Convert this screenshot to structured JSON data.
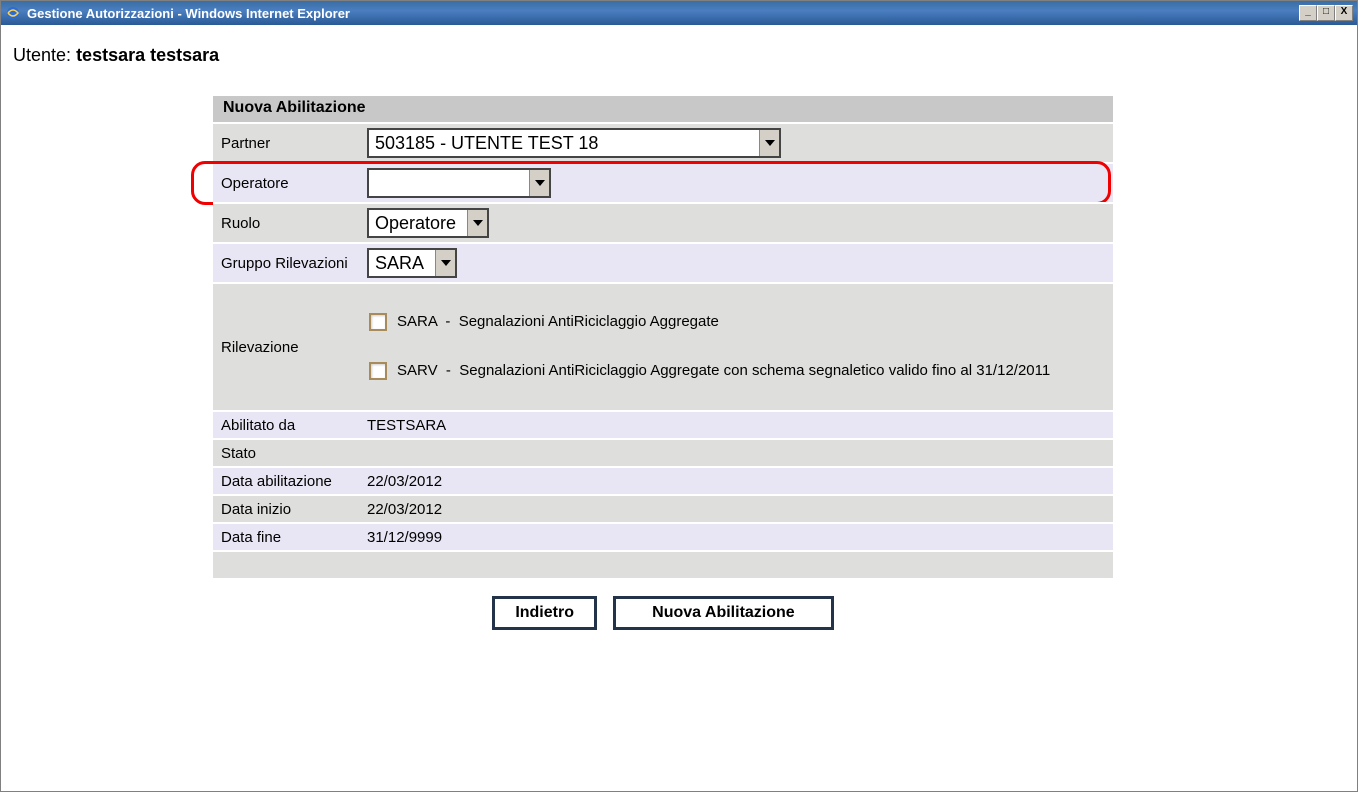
{
  "window": {
    "title": "Gestione Autorizzazioni - Windows Internet Explorer"
  },
  "user": {
    "label": "Utente:",
    "value": "testsara  testsara"
  },
  "panel": {
    "title": "Nuova Abilitazione"
  },
  "form": {
    "partner": {
      "label": "Partner",
      "value": "503185 - UTENTE TEST 18"
    },
    "operatore": {
      "label": "Operatore",
      "value": ""
    },
    "ruolo": {
      "label": "Ruolo",
      "value": "Operatore"
    },
    "gruppo": {
      "label": "Gruppo Rilevazioni",
      "value": "SARA"
    },
    "rilevazione": {
      "label": "Rilevazione",
      "items": [
        {
          "code": "SARA",
          "desc": "Segnalazioni AntiRiciclaggio Aggregate"
        },
        {
          "code": "SARV",
          "desc": "Segnalazioni AntiRiciclaggio Aggregate con schema segnaletico valido fino al 31/12/2011"
        }
      ]
    },
    "abilitato_da": {
      "label": "Abilitato da",
      "value": "TESTSARA"
    },
    "stato": {
      "label": "Stato",
      "value": ""
    },
    "data_abilitazione": {
      "label": "Data abilitazione",
      "value": "22/03/2012"
    },
    "data_inizio": {
      "label": "Data inizio",
      "value": "22/03/2012"
    },
    "data_fine": {
      "label": "Data fine",
      "value": "31/12/9999"
    }
  },
  "buttons": {
    "indietro": "Indietro",
    "nuova": "Nuova Abilitazione"
  }
}
